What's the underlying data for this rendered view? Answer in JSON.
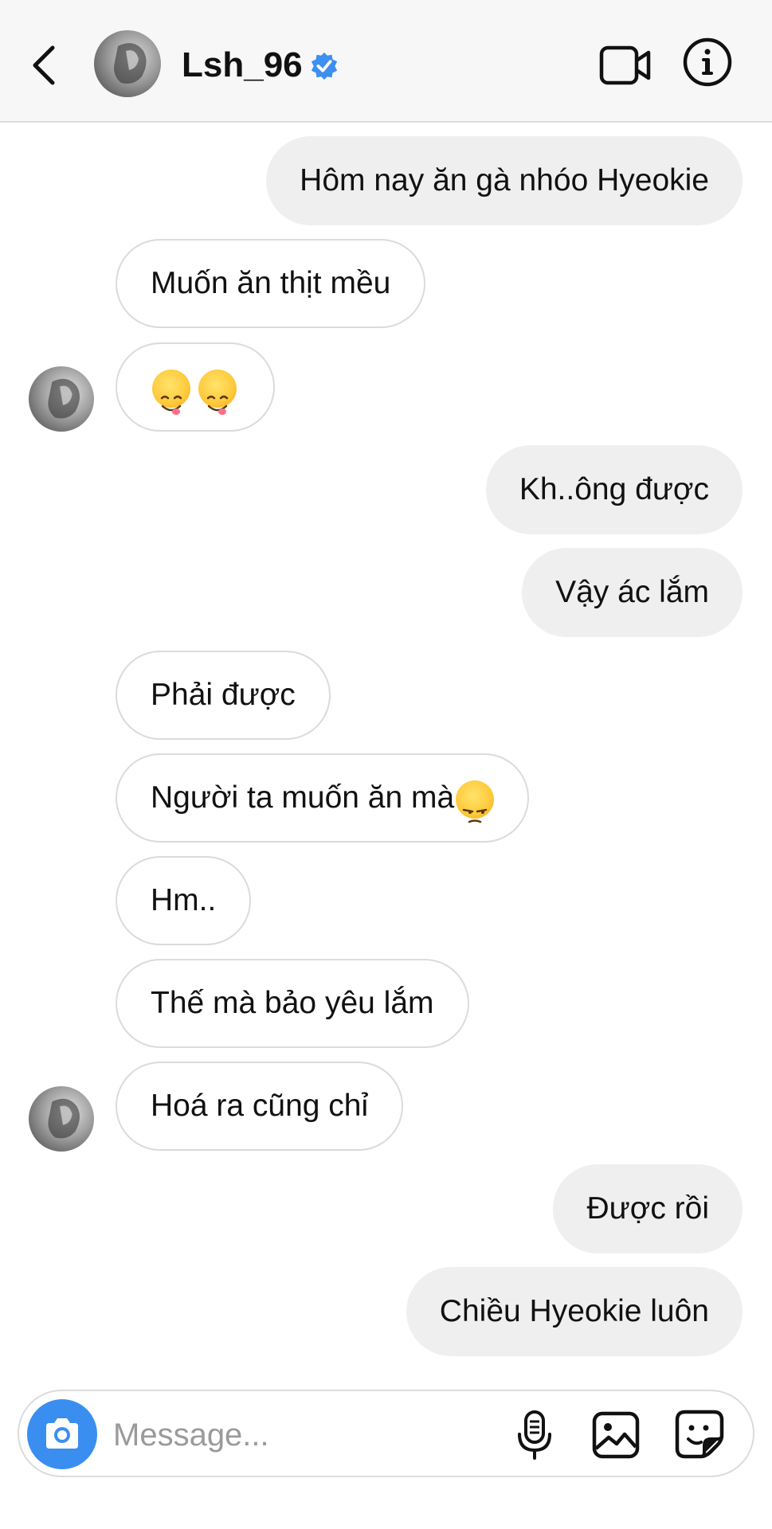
{
  "header": {
    "username": "Lsh_96",
    "back_icon": "chevron-left-icon",
    "verified_icon": "verified-badge-icon",
    "video_icon": "video-camera-icon",
    "info_icon": "info-icon"
  },
  "messages": [
    {
      "text": "Hôm nay ăn gà nhóo Hyeokie",
      "direction": "outgoing"
    },
    {
      "text": "Muốn ăn thịt mều",
      "direction": "incoming"
    },
    {
      "text": "",
      "emoji": "face-savoring-food x2",
      "direction": "incoming"
    },
    {
      "text": "Kh..ông được",
      "direction": "outgoing"
    },
    {
      "text": "Vậy ác lắm",
      "direction": "outgoing"
    },
    {
      "text": "Phải được",
      "direction": "incoming"
    },
    {
      "text": "Người ta muốn ăn mà",
      "emoji": "unamused-face",
      "direction": "incoming"
    },
    {
      "text": "Hm..",
      "direction": "incoming"
    },
    {
      "text": "Thế mà bảo yêu lắm",
      "direction": "incoming"
    },
    {
      "text": "Hoá ra cũng chỉ",
      "direction": "incoming"
    },
    {
      "text": "Được rồi",
      "direction": "outgoing"
    },
    {
      "text": "Chiều Hyeokie luôn",
      "direction": "outgoing"
    }
  ],
  "composer": {
    "placeholder": "Message...",
    "camera_icon": "camera-icon",
    "mic_icon": "microphone-icon",
    "gallery_icon": "gallery-icon",
    "sticker_icon": "sticker-icon"
  },
  "colors": {
    "accent_blue": "#3a8ef0",
    "outgoing_bubble": "#efefef",
    "incoming_border": "#dbdbdb"
  }
}
